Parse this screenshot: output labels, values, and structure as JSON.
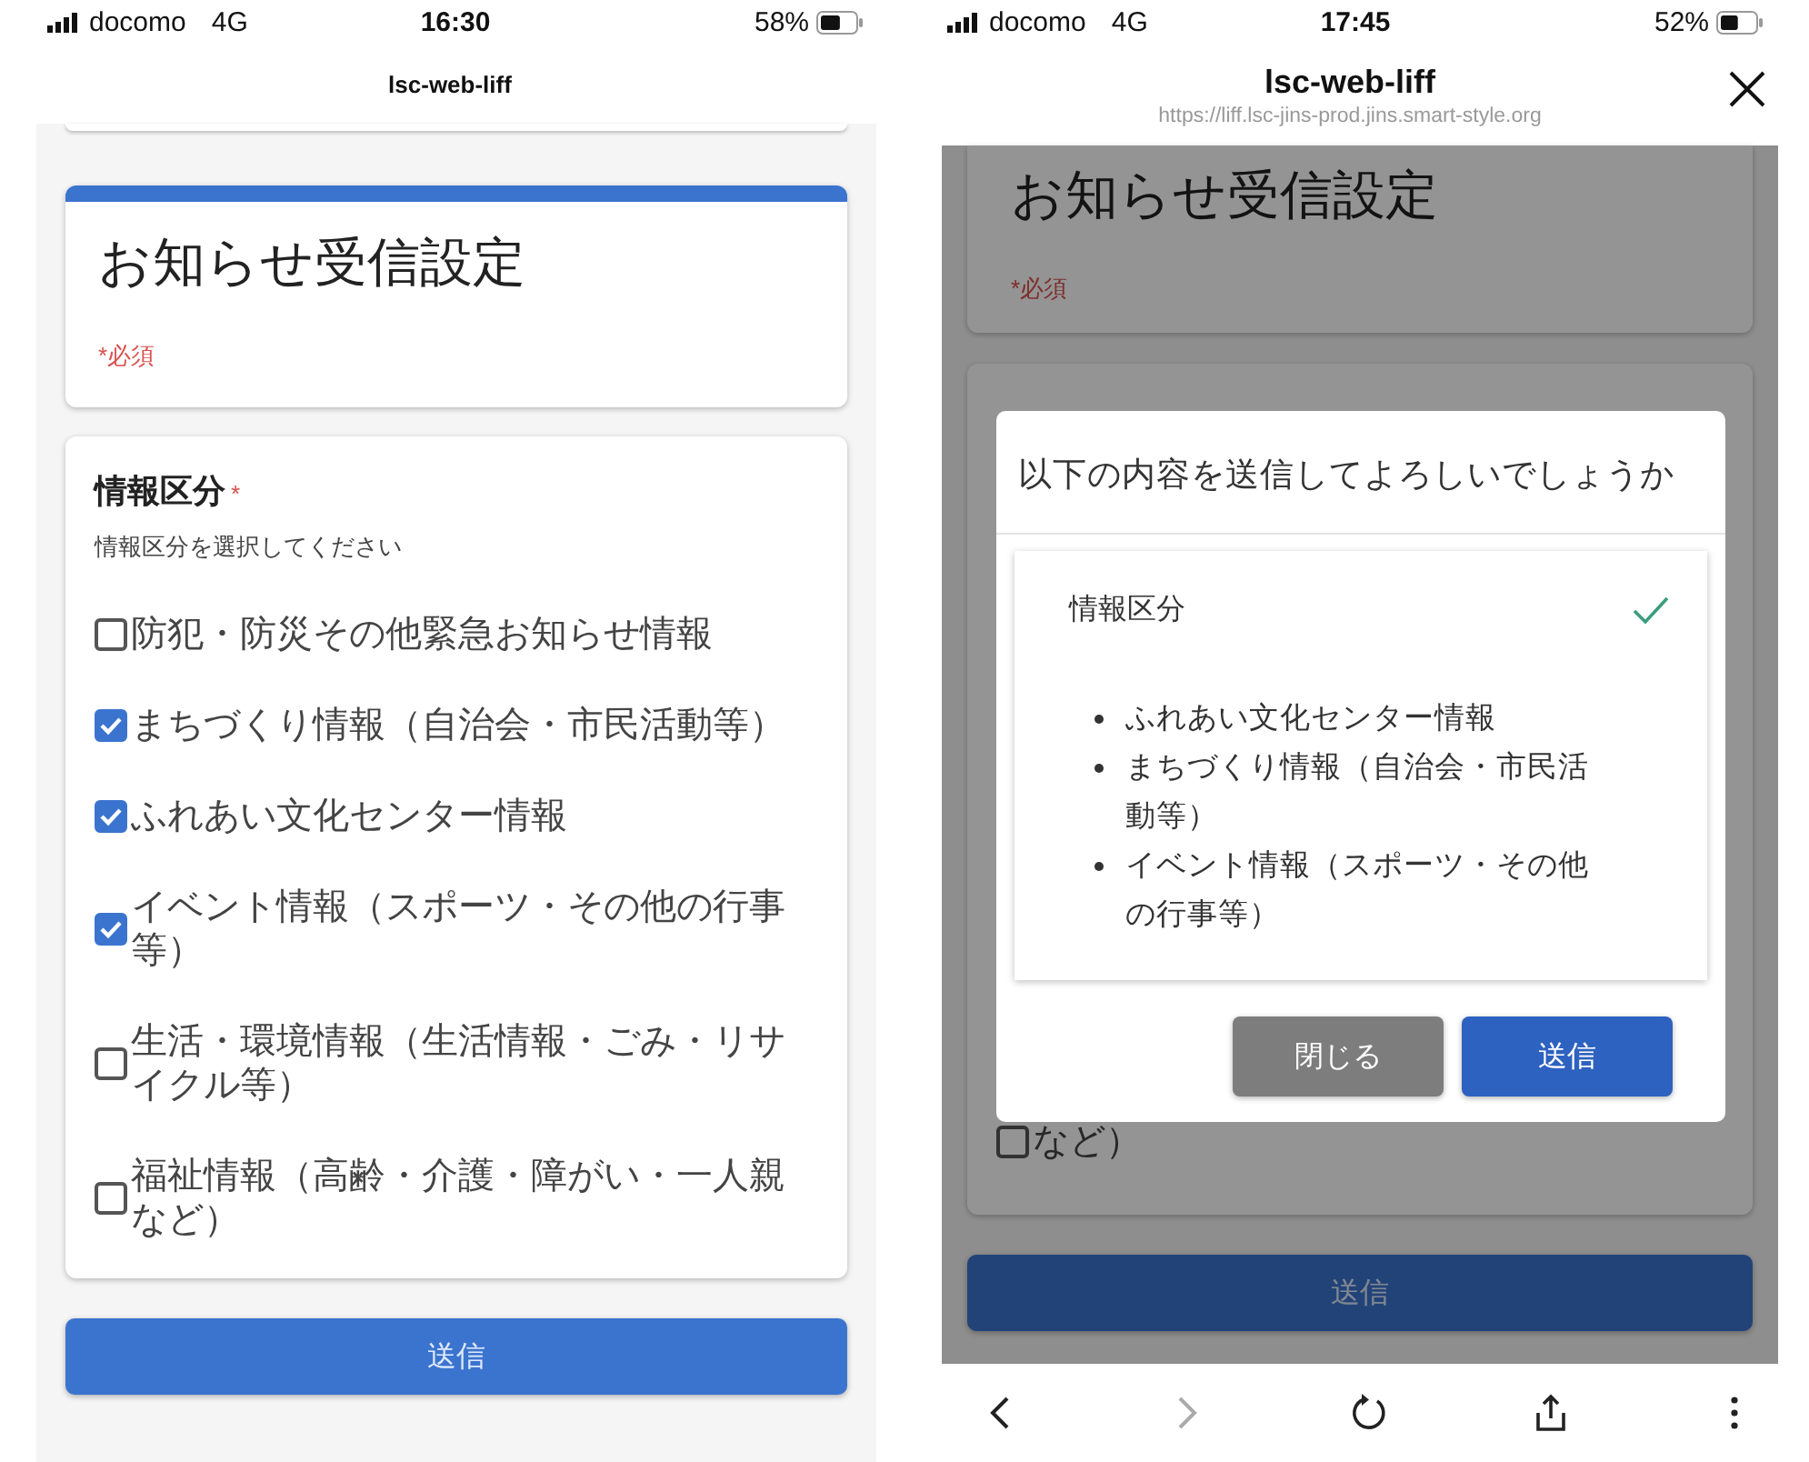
{
  "left_screen": {
    "status_bar": {
      "carrier": "docomo",
      "network": "4G",
      "time": "16:30",
      "battery": "58%"
    },
    "header": {
      "title": "lsc-web-liff"
    },
    "form": {
      "title": "お知らせ受信設定",
      "required_note": "*必須",
      "question": {
        "label": "情報区分",
        "required_mark": "*",
        "help": "情報区分を選択してください",
        "options": [
          {
            "label": "防犯・防災その他緊急お知らせ情報",
            "checked": false
          },
          {
            "label": "まちづくり情報（自治会・市民活動等）",
            "checked": true
          },
          {
            "label": "ふれあい文化センター情報",
            "checked": true
          },
          {
            "label": "イベント情報（スポーツ・その他の行事等）",
            "checked": true
          },
          {
            "label": "生活・環境情報（生活情報・ごみ・リサイクル等）",
            "checked": false
          },
          {
            "label": "福祉情報（高齢・介護・障がい・一人親など）",
            "checked": false
          }
        ]
      }
    },
    "submit": "送信"
  },
  "right_screen": {
    "status_bar": {
      "carrier": "docomo",
      "network": "4G",
      "time": "17:45",
      "battery": "52%"
    },
    "header": {
      "title": "lsc-web-liff",
      "url": "https://liff.lsc-jins-prod.jins.smart-style.org"
    },
    "form": {
      "title": "お知らせ受信設定",
      "required_note": "*必須",
      "visible_option": {
        "label": "など）",
        "checked": false
      }
    },
    "submit": "送信",
    "dialog": {
      "title": "以下の内容を送信してよろしいでしょうか",
      "section": {
        "label": "情報区分",
        "items": [
          "ふれあい文化センター情報",
          "まちづくり情報（自治会・市民活動等）",
          "イベント情報（スポーツ・その他の行事等）"
        ]
      },
      "buttons": [
        {
          "label": "閉じる",
          "kind": "secondary"
        },
        {
          "label": "送信",
          "kind": "primary"
        }
      ]
    },
    "toolbar": [
      {
        "kind": "back",
        "disabled": false
      },
      {
        "kind": "forward",
        "disabled": true
      },
      {
        "kind": "reload",
        "disabled": false
      },
      {
        "kind": "share",
        "disabled": false
      },
      {
        "kind": "more",
        "disabled": false
      }
    ]
  }
}
